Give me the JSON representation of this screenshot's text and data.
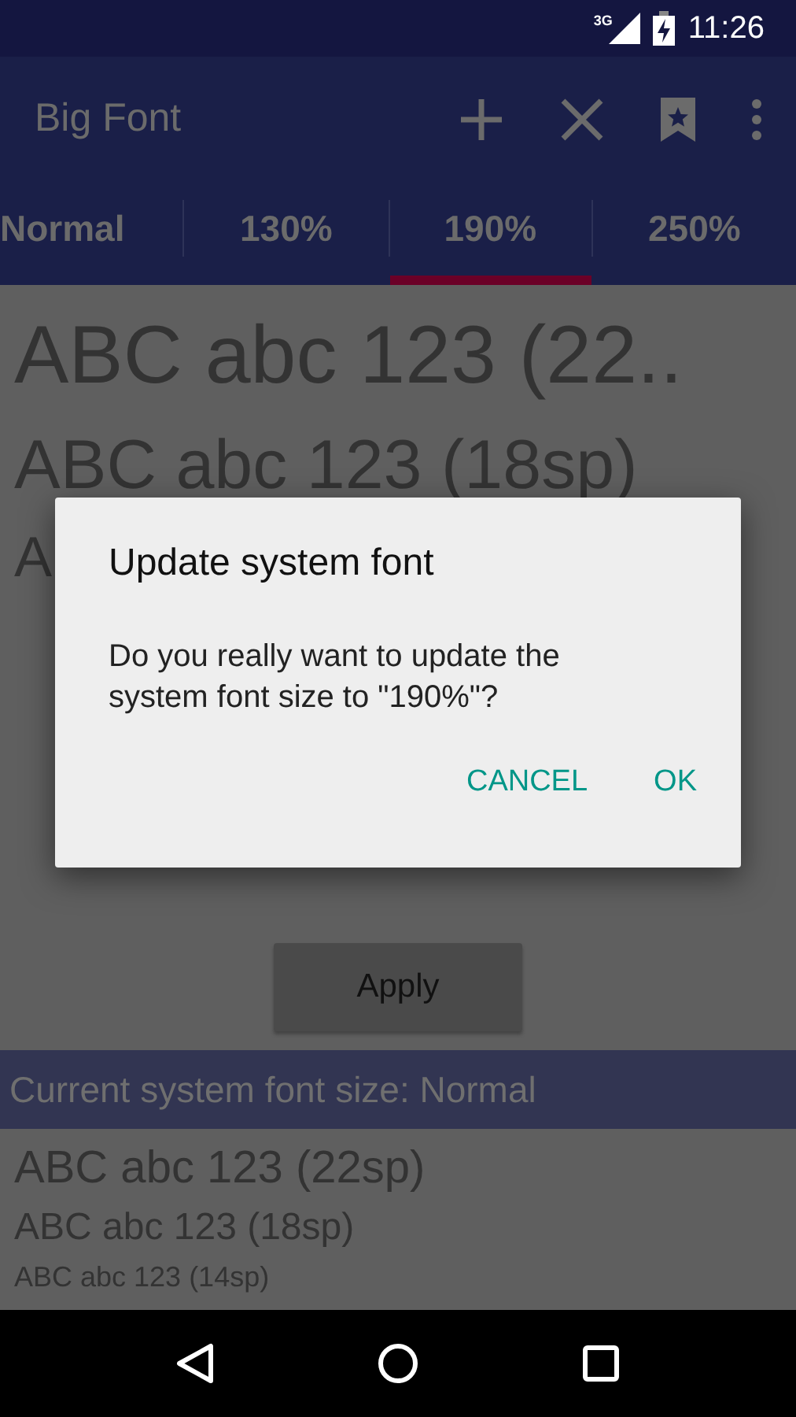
{
  "status_bar": {
    "network": "3G",
    "time": "11:26"
  },
  "app_bar": {
    "title": "Big Font"
  },
  "tabs": [
    {
      "label": "Normal",
      "selected": false
    },
    {
      "label": "130%",
      "selected": false
    },
    {
      "label": "190%",
      "selected": true
    },
    {
      "label": "250%",
      "selected": false
    }
  ],
  "preview": [
    "ABC abc 123 (22..",
    "ABC abc 123 (18sp)",
    "A"
  ],
  "apply_button": "Apply",
  "current_bar": "Current system font size: Normal",
  "current_samples": [
    "ABC abc 123 (22sp)",
    "ABC abc 123 (18sp)",
    "ABC abc 123 (14sp)"
  ],
  "dialog": {
    "title": "Update system font",
    "message": "Do you really want to update the system font size to \"190%\"?",
    "buttons": [
      "CANCEL",
      "OK"
    ]
  }
}
